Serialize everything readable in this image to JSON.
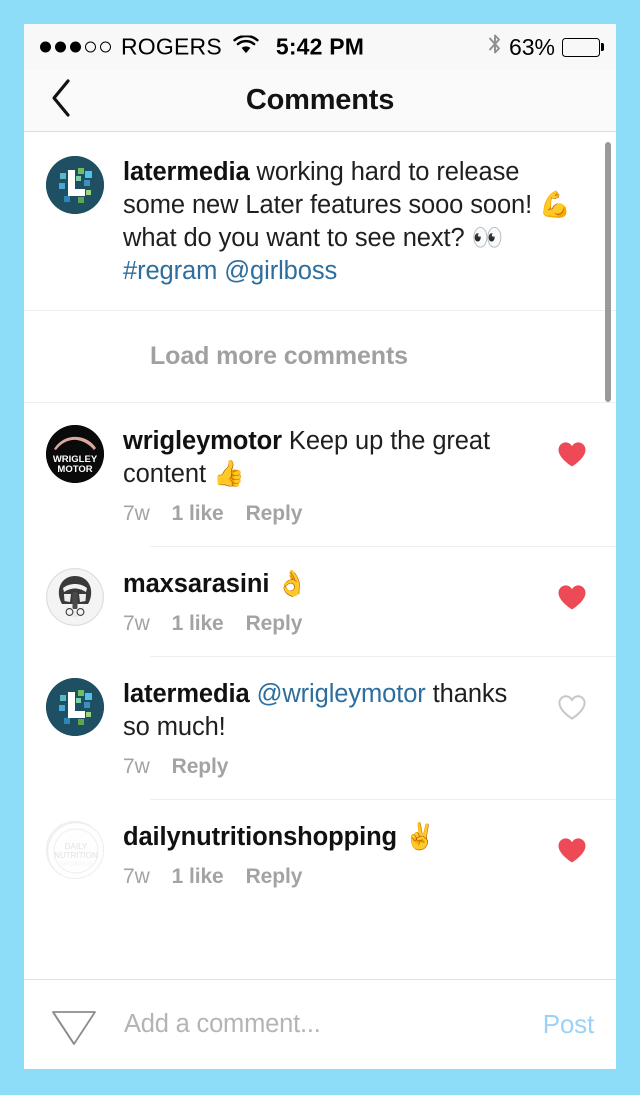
{
  "status_bar": {
    "signal_dots_filled": 3,
    "signal_dots_total": 5,
    "carrier": "ROGERS",
    "wifi_icon": "wifi-icon",
    "time": "5:42 PM",
    "bluetooth_icon": "bluetooth-icon",
    "battery_percent": "63%",
    "battery_level": 63
  },
  "nav": {
    "back_icon": "chevron-left-icon",
    "title": "Comments"
  },
  "caption": {
    "avatar": "latermedia-avatar",
    "username": "latermedia",
    "text_part1": " working hard to release some new Later features sooo soon! ",
    "emoji1": "💪",
    "text_part2": "  what do you want to see next? ",
    "emoji2": "👀",
    "hashtag": "#regram",
    "mention": "@girlboss"
  },
  "load_more": {
    "label": "Load more comments"
  },
  "comments": [
    {
      "avatar": "wrigleymotor-avatar",
      "username": "wrigleymotor",
      "text": " Keep up the great content ",
      "emoji": "👍",
      "time": "7w",
      "likes": "1 like",
      "reply": "Reply",
      "liked": true,
      "heart_icon": "heart-filled-icon"
    },
    {
      "avatar": "maxsarasini-avatar",
      "username": "maxsarasini",
      "text": " ",
      "emoji": "👌",
      "time": "7w",
      "likes": "1 like",
      "reply": "Reply",
      "liked": true,
      "heart_icon": "heart-filled-icon"
    },
    {
      "avatar": "latermedia-avatar",
      "username": "latermedia",
      "mention": "@wrigleymotor",
      "text": " thanks so much!",
      "emoji": "",
      "time": "7w",
      "likes": "",
      "reply": "Reply",
      "liked": false,
      "heart_icon": "heart-outline-icon"
    },
    {
      "avatar": "dailynutritionshopping-avatar",
      "username": "dailynutritionshopping",
      "text": " ",
      "emoji": "✌️",
      "time": "7w",
      "likes": "1 like",
      "reply": "Reply",
      "liked": true,
      "heart_icon": "heart-filled-icon"
    }
  ],
  "composer": {
    "send_icon": "send-paper-plane-icon",
    "placeholder": "Add a comment...",
    "value": "",
    "post_label": "Post"
  },
  "avatar_text": {
    "wrigley_line1": "WRIGLEY",
    "wrigley_line2": "MOTOR",
    "daily_line1": "DAILY",
    "daily_line2": "NUTRITION"
  },
  "colors": {
    "frame_blue": "#8DDCF8",
    "heart_red": "#ED4956",
    "heart_gray": "#C7C7C7",
    "link_blue": "#2D6E9E",
    "post_blue": "#9BD2F5",
    "meta_gray": "#A3A3A3"
  }
}
